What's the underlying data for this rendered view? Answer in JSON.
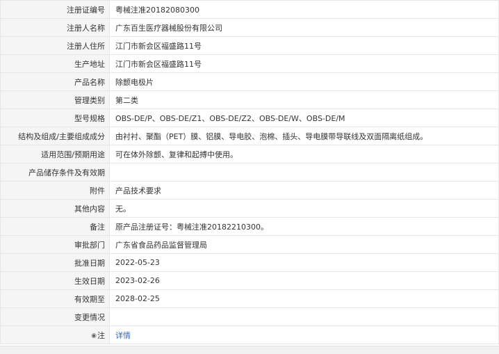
{
  "rows": [
    {
      "label": "注册证编号",
      "value": "粤械注准20182080300"
    },
    {
      "label": "注册人名称",
      "value": "广东百生医疗器械股份有限公司"
    },
    {
      "label": "注册人住所",
      "value": "江门市新会区福盛路11号"
    },
    {
      "label": "生产地址",
      "value": "江门市新会区福盛路11号"
    },
    {
      "label": "产品名称",
      "value": "除颤电极片"
    },
    {
      "label": "管理类别",
      "value": "第二类"
    },
    {
      "label": "型号规格",
      "value": "OBS-DE/P、OBS-DE/Z1、OBS-DE/Z2、OBS-DE/W、OBS-DE/M"
    },
    {
      "label": "结构及组成/主要组成成分",
      "value": "由衬衬、聚酯（PET）膜、铝膜、导电胶、泡棉、插头、导电膜带导联线及双面隔离纸组成。"
    },
    {
      "label": "适用范围/预期用途",
      "value": "可在体外除颤、复律和起搏中使用。"
    },
    {
      "label": "产品储存条件及有效期",
      "value": ""
    },
    {
      "label": "附件",
      "value": "产品技术要求"
    },
    {
      "label": "其他内容",
      "value": "无。"
    },
    {
      "label": "备注",
      "value": "原产品注册证号：粤械注准20182210300。"
    },
    {
      "label": "审批部门",
      "value": "广东省食品药品监督管理局"
    },
    {
      "label": "批准日期",
      "value": "2022-05-23"
    },
    {
      "label": "生效日期",
      "value": "2023-02-26"
    },
    {
      "label": "有效期至",
      "value": "2028-02-25"
    },
    {
      "label": "变更情况",
      "value": ""
    }
  ],
  "note_row": {
    "label": "注",
    "pin_icon": "pin-icon",
    "link_text": "详情"
  }
}
